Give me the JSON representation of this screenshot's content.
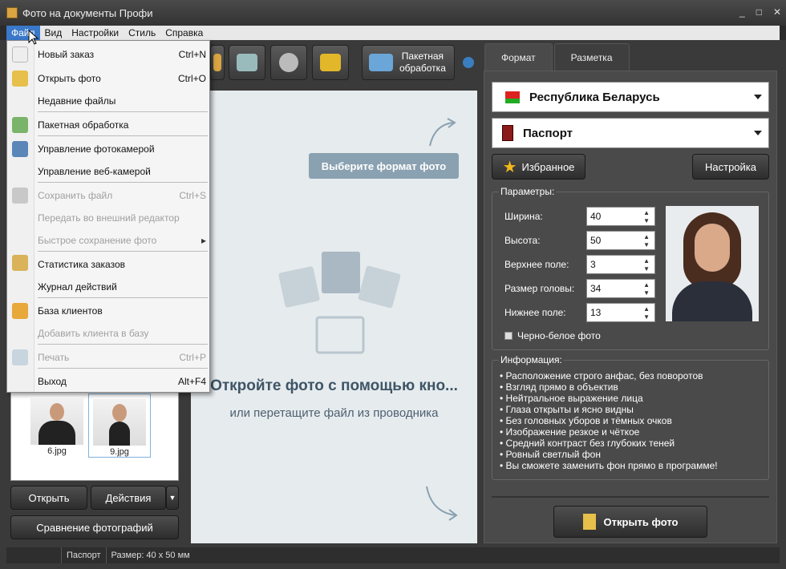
{
  "window": {
    "title": "Фото на документы Профи",
    "controls": [
      "_",
      "□",
      "✕"
    ]
  },
  "menubar": [
    "Файл",
    "Вид",
    "Настройки",
    "Стиль",
    "Справка"
  ],
  "file_menu": [
    {
      "label": "Новый заказ",
      "shortcut": "Ctrl+N",
      "disabled": false
    },
    {
      "label": "Открыть фото",
      "shortcut": "Ctrl+O",
      "disabled": false
    },
    {
      "label": "Недавние файлы",
      "shortcut": "",
      "disabled": false
    },
    {
      "label": "Пакетная обработка",
      "shortcut": "",
      "disabled": false
    },
    {
      "label": "Управление  фотокамерой",
      "shortcut": "",
      "disabled": false
    },
    {
      "label": "Управление веб-камерой",
      "shortcut": "",
      "disabled": false
    },
    {
      "label": "Сохранить файл",
      "shortcut": "Ctrl+S",
      "disabled": true
    },
    {
      "label": "Передать во внешний редактор",
      "shortcut": "",
      "disabled": true
    },
    {
      "label": "Быстрое сохранение фото",
      "shortcut": "▸",
      "disabled": true
    },
    {
      "label": "Статистика заказов",
      "shortcut": "",
      "disabled": false
    },
    {
      "label": "Журнал действий",
      "shortcut": "",
      "disabled": false
    },
    {
      "label": "База клиентов",
      "shortcut": "",
      "disabled": false
    },
    {
      "label": "Добавить клиента в базу",
      "shortcut": "",
      "disabled": true
    },
    {
      "label": "Печать",
      "shortcut": "Ctrl+P",
      "disabled": true
    },
    {
      "label": "Выход",
      "shortcut": "Alt+F4",
      "disabled": false
    }
  ],
  "toolbar": {
    "batch_label_1": "Пакетная",
    "batch_label_2": "обработка"
  },
  "center": {
    "choose_format": "Выберите формат фото",
    "open_title": "Откройте фото с помощью кно...",
    "open_sub": "или перетащите файл из проводника"
  },
  "thumbnails": [
    {
      "name": "6.jpg"
    },
    {
      "name": "9.jpg"
    }
  ],
  "left_buttons": {
    "open": "Открыть",
    "actions": "Действия",
    "compare": "Сравнение фотографий"
  },
  "tabs": [
    "Формат",
    "Разметка"
  ],
  "country": "Республика Беларусь",
  "doc_type": "Паспорт",
  "favorites": "Избранное",
  "settings": "Настройка",
  "params": {
    "title": "Параметры:",
    "fields": [
      {
        "label": "Ширина:",
        "value": "40"
      },
      {
        "label": "Высота:",
        "value": "50"
      },
      {
        "label": "Верхнее поле:",
        "value": "3"
      },
      {
        "label": "Размер головы:",
        "value": "34"
      },
      {
        "label": "Нижнее поле:",
        "value": "13"
      }
    ],
    "bw_label": "Черно-белое фото"
  },
  "info": {
    "title": "Информация:",
    "items": [
      "Расположение строго анфас, без поворотов",
      "Взгляд прямо в объектив",
      "Нейтральное выражение лица",
      "Глаза открыты и ясно видны",
      "Без головных уборов и тёмных очков",
      "Изображение резкое и чёткое",
      "Средний контраст без глубоких теней",
      "Ровный светлый фон",
      "Вы сможете заменить фон прямо в программе!"
    ]
  },
  "open_photo_button": "Открыть фото",
  "status": {
    "doc": "Паспорт",
    "size": "Размер: 40 x 50 мм"
  }
}
